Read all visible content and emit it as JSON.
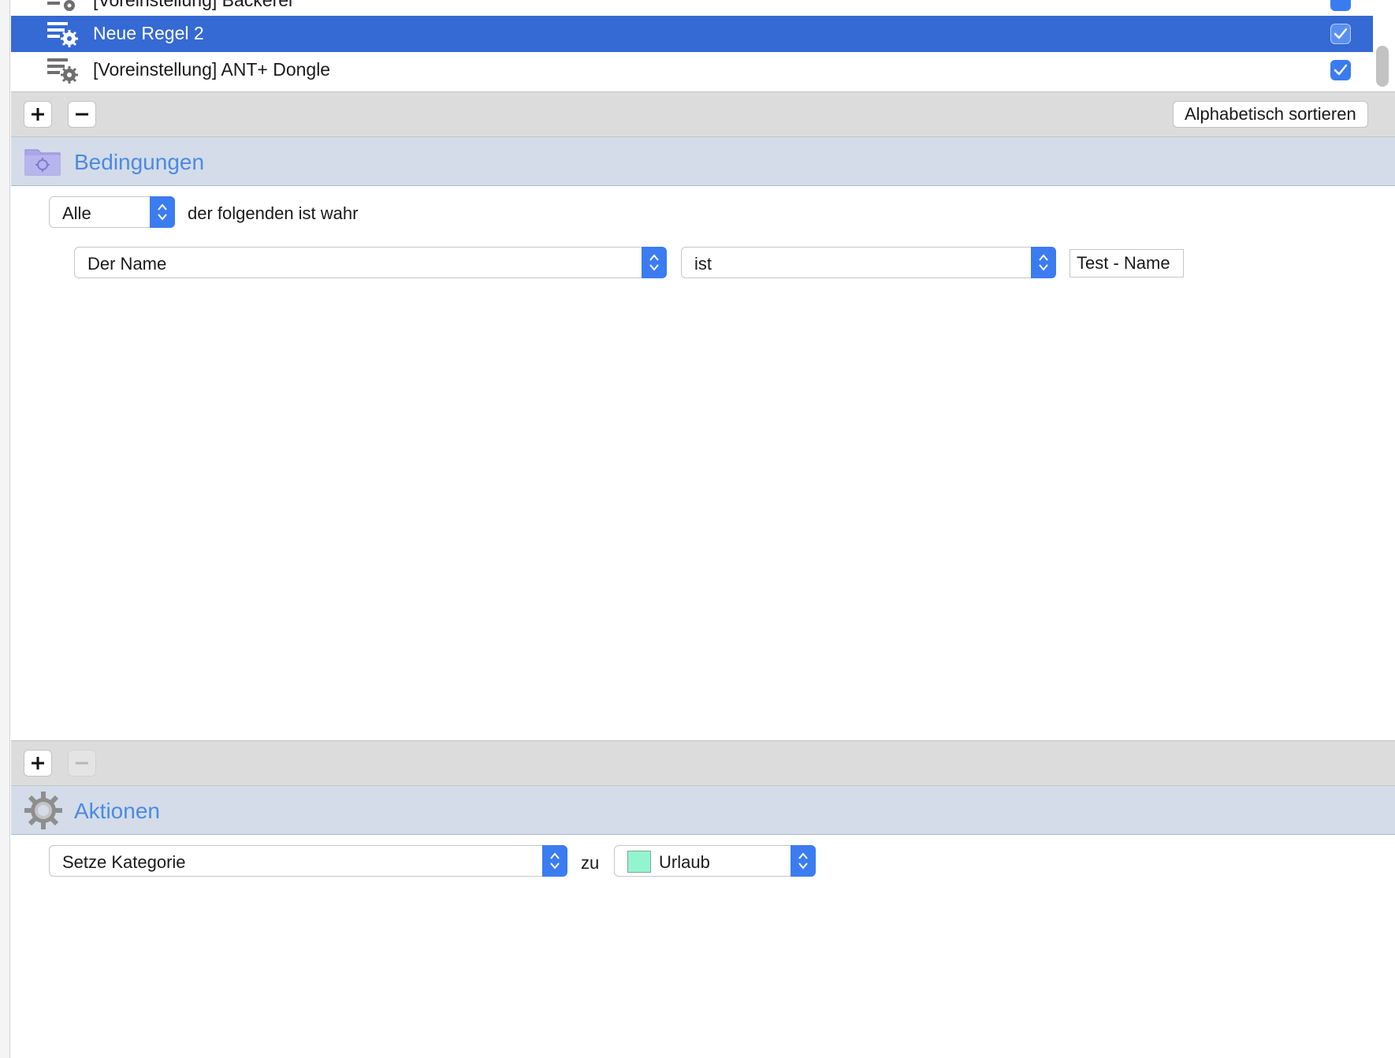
{
  "rules": {
    "items": [
      {
        "label": "[Voreinstellung] Bäckerei",
        "checked": true,
        "selected": false
      },
      {
        "label": "Neue Regel 2",
        "checked": true,
        "selected": true
      },
      {
        "label": "[Voreinstellung] ANT+ Dongle",
        "checked": true,
        "selected": false
      }
    ],
    "add_label": "+",
    "remove_label": "−",
    "sort_label": "Alphabetisch sortieren"
  },
  "conditions": {
    "title": "Bedingungen",
    "match_selector": "Alle",
    "match_suffix": "der folgenden ist wahr",
    "row": {
      "field": "Der Name",
      "operator": "ist",
      "value": "Test - Name"
    }
  },
  "actions": {
    "title": "Aktionen",
    "action": "Setze Kategorie",
    "connector": "zu",
    "category": "Urlaub",
    "category_color": "#93f5d0"
  },
  "colors": {
    "selection": "#3569d3",
    "accent": "#3b7cf0",
    "section_title": "#4c8ae2"
  }
}
